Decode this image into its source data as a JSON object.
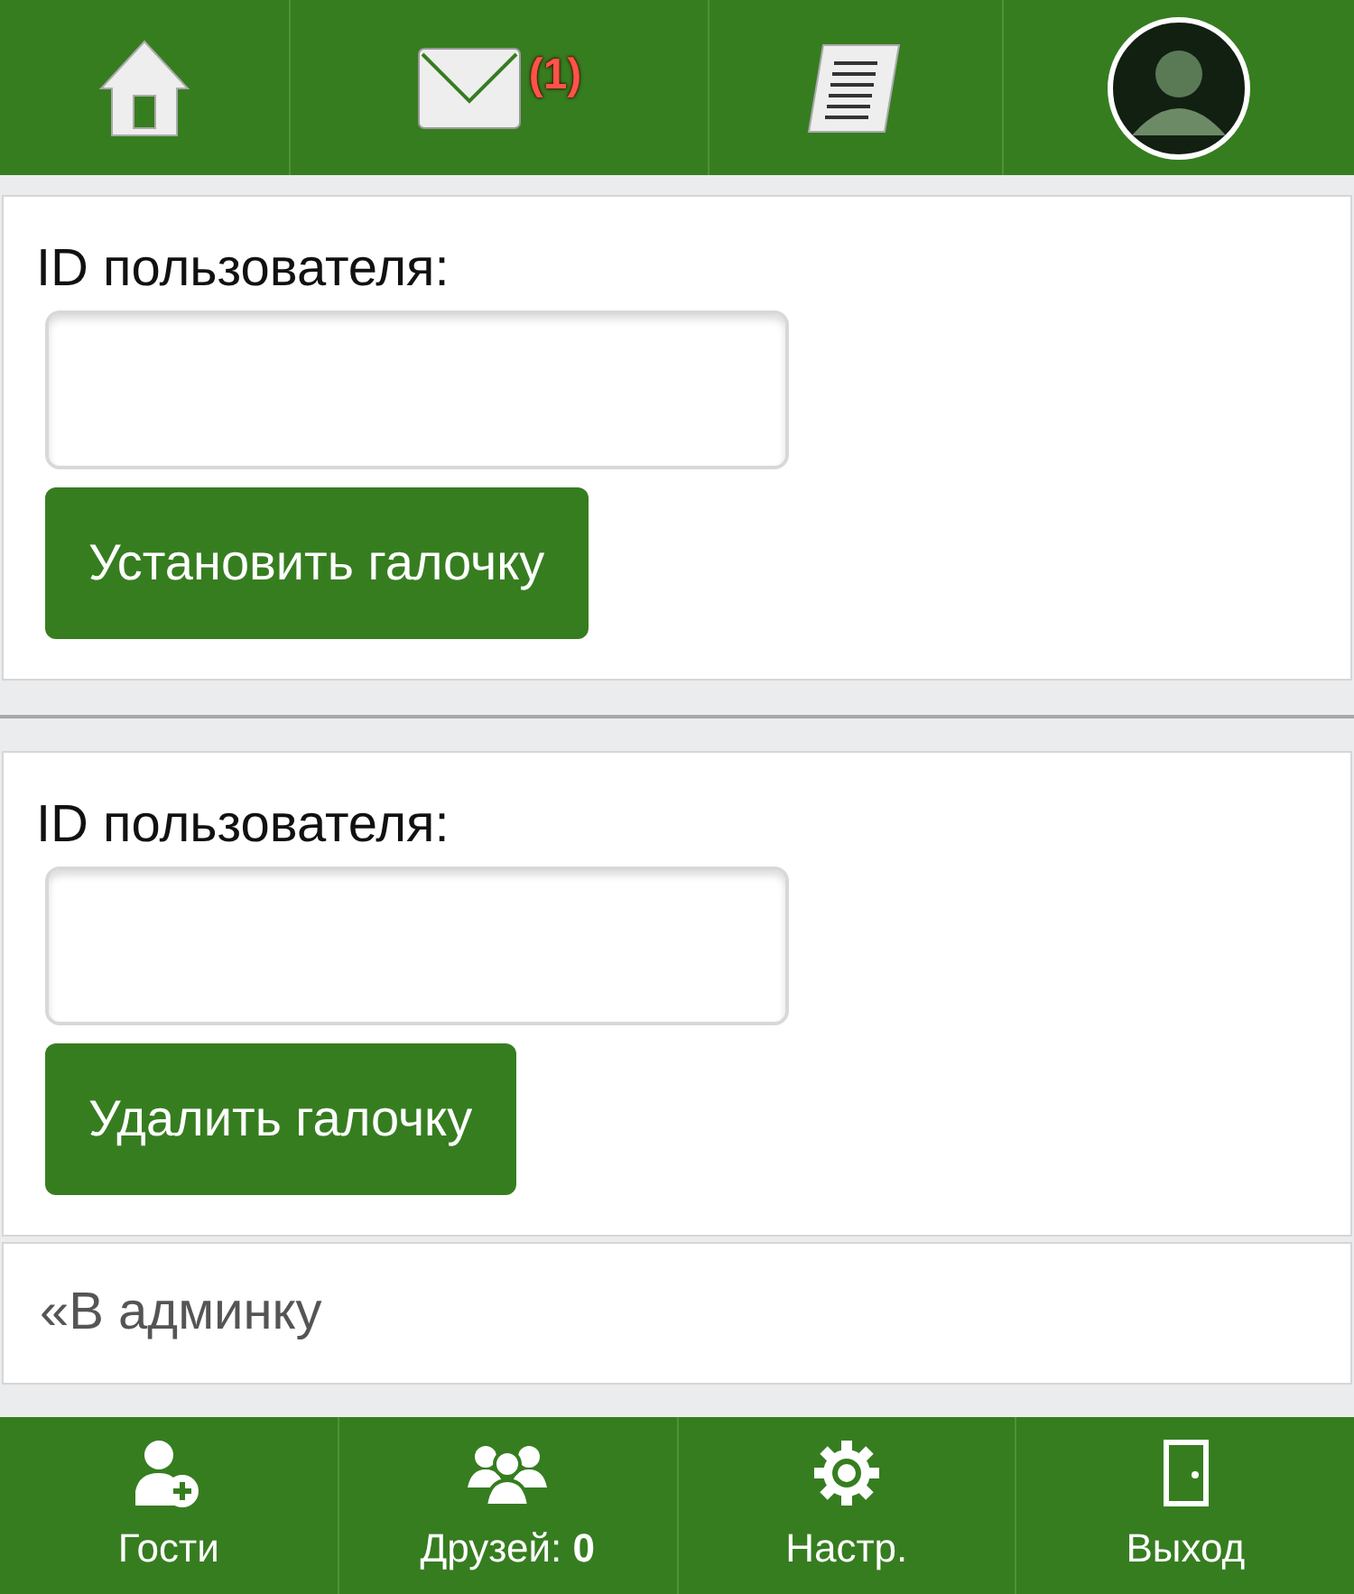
{
  "top_nav": [
    {
      "kind": "home"
    },
    {
      "kind": "mail",
      "badge": "(1)"
    },
    {
      "kind": "scroll"
    },
    {
      "kind": "avatar"
    }
  ],
  "forms": [
    {
      "label": "ID пользователя:",
      "button": "Установить галочку"
    },
    {
      "label": "ID пользователя:",
      "button": "Удалить галочку"
    }
  ],
  "back_link": "«В админку",
  "bottom_nav": [
    {
      "kind": "guests",
      "label": "Гости"
    },
    {
      "kind": "friends",
      "label": "Друзей: **0**"
    },
    {
      "kind": "settings",
      "label": "Настр."
    },
    {
      "kind": "exit",
      "label": "Выход"
    }
  ]
}
